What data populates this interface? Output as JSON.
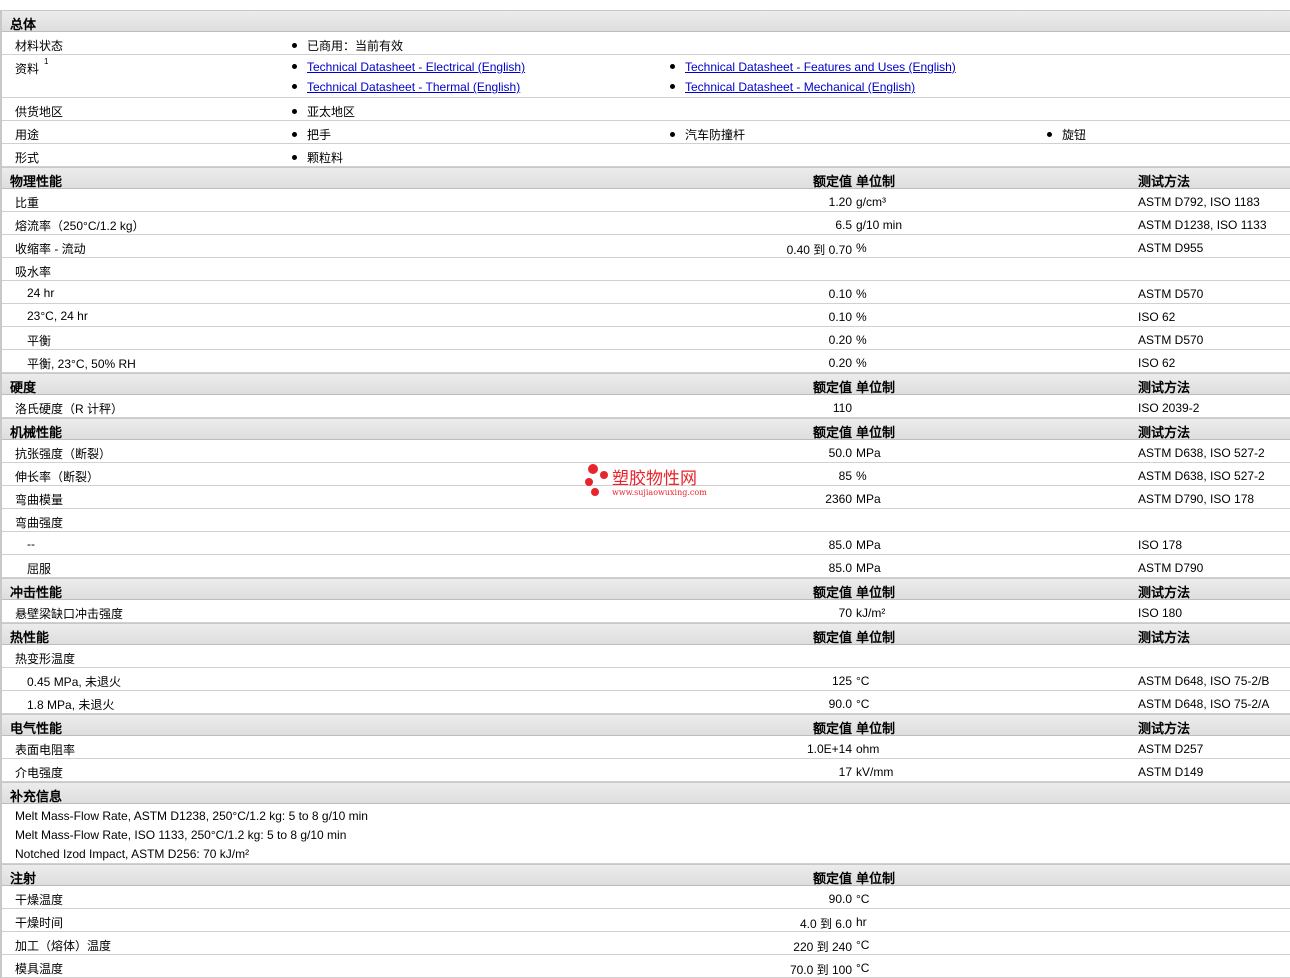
{
  "general": {
    "title": "总体",
    "rows": [
      {
        "label": "材料状态",
        "items": [
          "已商用：当前有效"
        ]
      },
      {
        "label": "资料",
        "sup": "1",
        "links": [
          "Technical Datasheet - Electrical (English)",
          "Technical Datasheet - Features and Uses (English)",
          "Technical Datasheet - Thermal (English)",
          "Technical Datasheet - Mechanical (English)"
        ]
      },
      {
        "label": "供货地区",
        "items": [
          "亚太地区"
        ]
      },
      {
        "label": "用途",
        "items": [
          "把手",
          "汽车防撞杆",
          "旋钮"
        ]
      },
      {
        "label": "形式",
        "items": [
          "颗粒料"
        ]
      }
    ]
  },
  "col_headers": {
    "value": "额定值",
    "unit": "单位制",
    "method": "测试方法"
  },
  "sections": [
    {
      "title": "物理性能",
      "rows": [
        {
          "label": "比重",
          "value": "1.20",
          "unit": "g/cm³",
          "method": "ASTM D792, ISO 1183"
        },
        {
          "label": "熔流率（250°C/1.2 kg）",
          "value": "6.5",
          "unit": "g/10 min",
          "method": "ASTM D1238, ISO 1133"
        },
        {
          "label": "收缩率 - 流动",
          "value": "0.40 到  0.70",
          "unit": "%",
          "method": "ASTM D955"
        },
        {
          "label": "吸水率"
        },
        {
          "label": "24 hr",
          "sub": true,
          "value": "0.10",
          "unit": "%",
          "method": "ASTM D570"
        },
        {
          "label": "23°C, 24 hr",
          "sub": true,
          "value": "0.10",
          "unit": "%",
          "method": "ISO 62"
        },
        {
          "label": "平衡",
          "sub": true,
          "value": "0.20",
          "unit": "%",
          "method": "ASTM D570"
        },
        {
          "label": "平衡, 23°C, 50% RH",
          "sub": true,
          "value": "0.20",
          "unit": "%",
          "method": "ISO 62"
        }
      ]
    },
    {
      "title": "硬度",
      "rows": [
        {
          "label": "洛氏硬度（R 计秤）",
          "value": "110",
          "unit": "",
          "method": "ISO 2039-2"
        }
      ]
    },
    {
      "title": "机械性能",
      "rows": [
        {
          "label": "抗张强度（断裂）",
          "value": "50.0",
          "unit": "MPa",
          "method": "ASTM D638, ISO 527-2"
        },
        {
          "label": "伸长率（断裂）",
          "value": "85",
          "unit": "%",
          "method": "ASTM D638, ISO 527-2"
        },
        {
          "label": "弯曲模量",
          "value": "2360",
          "unit": "MPa",
          "method": "ASTM D790, ISO 178"
        },
        {
          "label": "弯曲强度"
        },
        {
          "label": "--",
          "sub": true,
          "value": "85.0",
          "unit": "MPa",
          "method": "ISO 178"
        },
        {
          "label": "屈服",
          "sub": true,
          "value": "85.0",
          "unit": "MPa",
          "method": "ASTM D790"
        }
      ]
    },
    {
      "title": "冲击性能",
      "rows": [
        {
          "label": "悬壁梁缺口冲击强度",
          "value": "70",
          "unit": "kJ/m²",
          "method": "ISO 180"
        }
      ]
    },
    {
      "title": "热性能",
      "rows": [
        {
          "label": "热变形温度"
        },
        {
          "label": "0.45 MPa, 未退火",
          "sub": true,
          "value": "125",
          "unit": "°C",
          "method": "ASTM D648, ISO 75-2/B"
        },
        {
          "label": "1.8 MPa, 未退火",
          "sub": true,
          "value": "90.0",
          "unit": "°C",
          "method": "ASTM D648, ISO 75-2/A"
        }
      ]
    },
    {
      "title": "电气性能",
      "rows": [
        {
          "label": "表面电阻率",
          "value": "1.0E+14",
          "unit": "ohm",
          "method": "ASTM D257"
        },
        {
          "label": "介电强度",
          "value": "17",
          "unit": "kV/mm",
          "method": "ASTM D149"
        }
      ]
    }
  ],
  "supplementary": {
    "title": "补充信息",
    "notes": [
      "Melt Mass-Flow Rate, ASTM D1238, 250°C/1.2 kg: 5 to 8 g/10 min",
      "Melt Mass-Flow Rate, ISO 1133, 250°C/1.2 kg: 5 to 8 g/10 min",
      "Notched Izod Impact, ASTM D256: 70 kJ/m²"
    ]
  },
  "injection": {
    "title": "注射",
    "rows": [
      {
        "label": "干燥温度",
        "value": "90.0",
        "unit": "°C"
      },
      {
        "label": "干燥时间",
        "value": "4.0 到  6.0",
        "unit": "hr"
      },
      {
        "label": "加工（熔体）温度",
        "value": "220 到  240",
        "unit": "°C"
      },
      {
        "label": "模具温度",
        "value": "70.0 到  100",
        "unit": "°C"
      }
    ]
  },
  "watermark": {
    "text": "塑胶物性网",
    "url": "www.sujiaowuxing.com"
  },
  "colors": {
    "link": "#0000cc",
    "header_bg": "#e4e4e4",
    "watermark": "#e8242c"
  }
}
